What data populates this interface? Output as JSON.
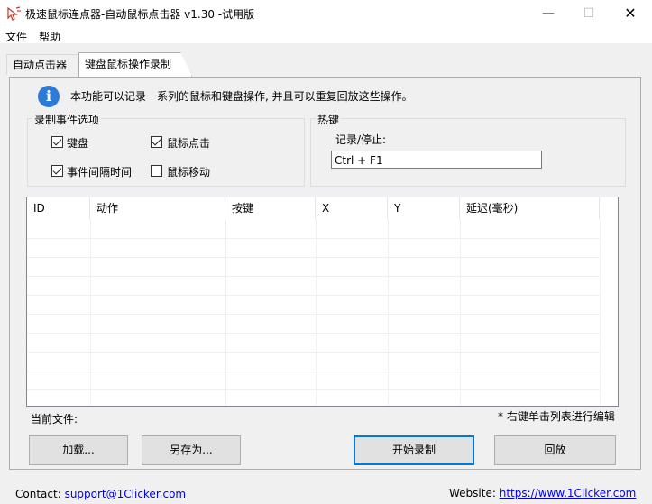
{
  "window": {
    "title": "极速鼠标连点器-自动鼠标点击器 v1.30  -试用版",
    "minimize": "—",
    "maximize": "☐",
    "close": "✕"
  },
  "menu": {
    "file": "文件",
    "help": "帮助"
  },
  "tabs": [
    {
      "label": "自动点击器"
    },
    {
      "label": "键盘鼠标操作录制",
      "active": true
    }
  ],
  "info": {
    "icon": "i",
    "text": "本功能可以记录一系列的鼠标和键盘操作, 并且可以重复回放这些操作。"
  },
  "record_options": {
    "title": "录制事件选项",
    "keyboard": {
      "label": "键盘",
      "checked": true
    },
    "mouse_click": {
      "label": "鼠标点击",
      "checked": true
    },
    "event_interval": {
      "label": "事件间隔时间",
      "checked": true
    },
    "mouse_move": {
      "label": "鼠标移动",
      "checked": false
    }
  },
  "hotkey": {
    "title": "热键",
    "label": "记录/停止:",
    "value": "Ctrl + F1"
  },
  "table": {
    "columns": [
      "ID",
      "动作",
      "按键",
      "X",
      "Y",
      "延迟(毫秒)"
    ],
    "rows": []
  },
  "current_file_label": "当前文件:",
  "hint": "* 右键单击列表进行编辑",
  "buttons": {
    "load": "加载...",
    "save_as": "另存为...",
    "start_record": "开始录制",
    "playback": "回放"
  },
  "footer": {
    "contact_label": "Contact:",
    "contact_email": "support@1Clicker.com",
    "website_label": "Website:",
    "website_url": "https://www.1Clicker.com"
  }
}
